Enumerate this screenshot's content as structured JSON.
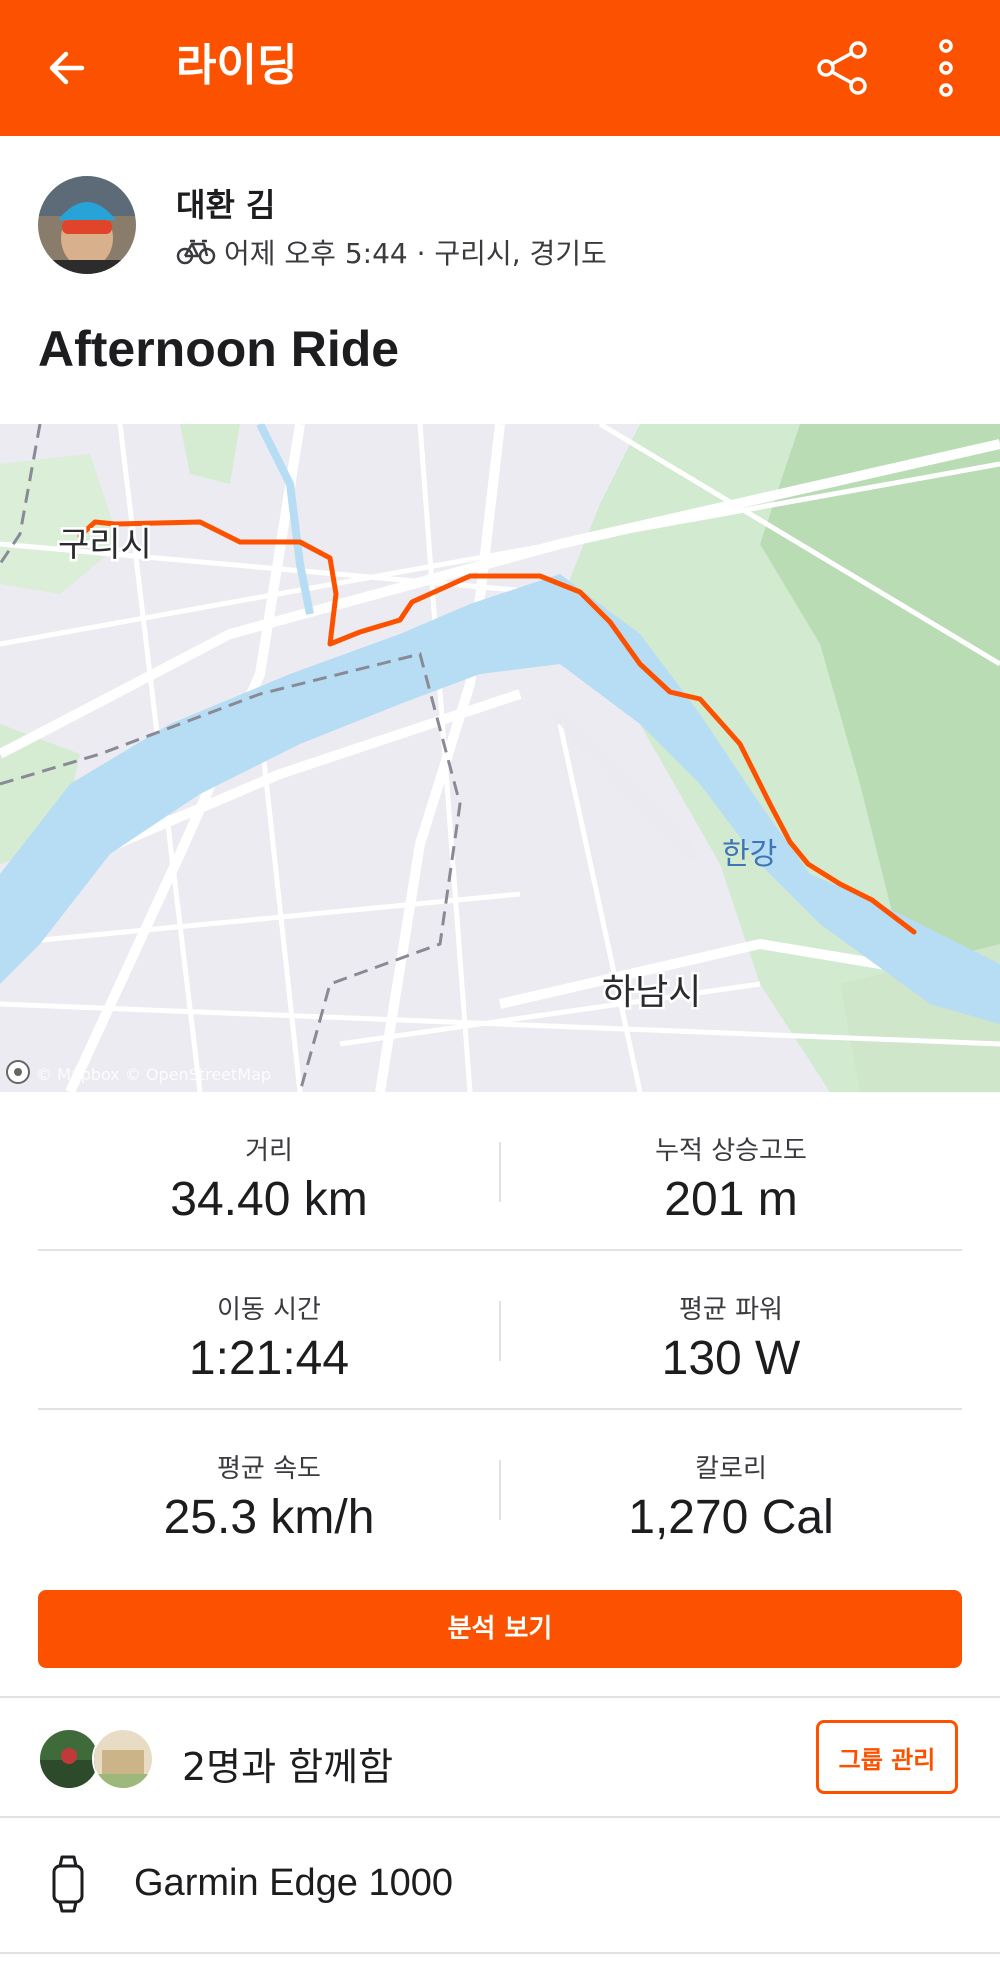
{
  "appbar": {
    "title": "라이딩"
  },
  "activity": {
    "athlete_name": "대환 김",
    "meta": "어제 오후 5:44 · 구리시, 경기도",
    "title": "Afternoon Ride"
  },
  "map": {
    "labels": {
      "guri": "구리시",
      "hanam": "하남시",
      "hangang": "한강"
    },
    "attribution": "© Mapbox © OpenStreetMap"
  },
  "stats": [
    {
      "label": "거리",
      "value": "34.40 km"
    },
    {
      "label": "누적 상승고도",
      "value": "201 m"
    },
    {
      "label": "이동 시간",
      "value": "1:21:44"
    },
    {
      "label": "평균 파워",
      "value": "130 W"
    },
    {
      "label": "평균 속도",
      "value": "25.3 km/h"
    },
    {
      "label": "칼로리",
      "value": "1,270 Cal"
    }
  ],
  "buttons": {
    "analyze": "분석 보기",
    "group_manage": "그룹 관리"
  },
  "group": {
    "label": "2명과 함께함"
  },
  "device": {
    "name": "Garmin Edge 1000"
  },
  "colors": {
    "brand": "#fc5200",
    "river": "#b6ddf3",
    "green": "#cde8c8",
    "route": "#fc5200"
  },
  "icons": [
    "back-arrow-icon",
    "share-icon",
    "more-vert-icon",
    "bike-icon",
    "watch-icon",
    "mapbox-logo-icon"
  ]
}
